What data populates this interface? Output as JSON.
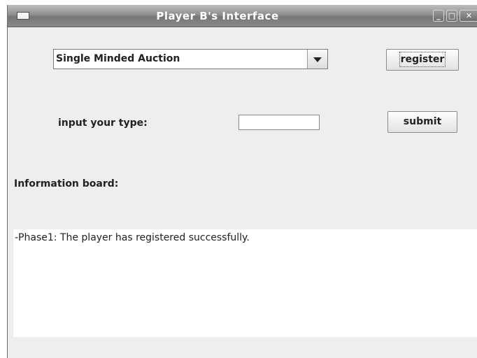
{
  "window": {
    "title": "Player B's Interface",
    "controls": {
      "minimize": "_",
      "maximize": "□",
      "close": "✕"
    }
  },
  "auction_select": {
    "selected": "Single Minded Auction"
  },
  "buttons": {
    "register": "register",
    "submit": "submit"
  },
  "type_field": {
    "label": "input your type:",
    "value": ""
  },
  "info_board": {
    "label": "Information board:",
    "lines": [
      "-Phase1: The player has registered successfully."
    ]
  },
  "icons": {
    "window_menu": "window-menu-icon",
    "dropdown": "chevron-down-icon"
  }
}
